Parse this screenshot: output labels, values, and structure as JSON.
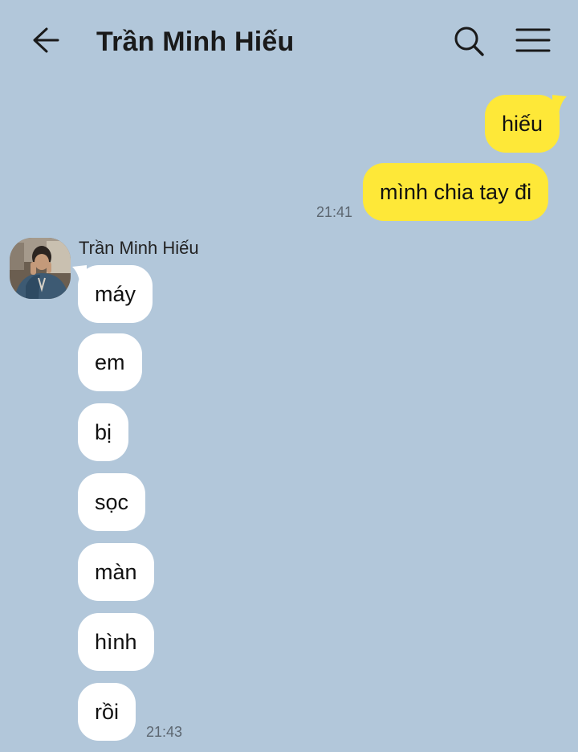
{
  "header": {
    "title": "Trần Minh Hiếu",
    "back_icon": "arrow-left-icon",
    "search_icon": "search-icon",
    "menu_icon": "hamburger-menu-icon"
  },
  "colors": {
    "background": "#b2c7da",
    "outgoing_bubble": "#fee838",
    "incoming_bubble": "#ffffff"
  },
  "outgoing": {
    "messages": [
      "hiếu",
      "mình chia tay đi"
    ],
    "time": "21:41"
  },
  "incoming": {
    "sender": "Trần Minh Hiếu",
    "messages": [
      "máy",
      "em",
      "bị",
      "sọc",
      "màn",
      "hình",
      "rồi"
    ],
    "time": "21:43"
  }
}
